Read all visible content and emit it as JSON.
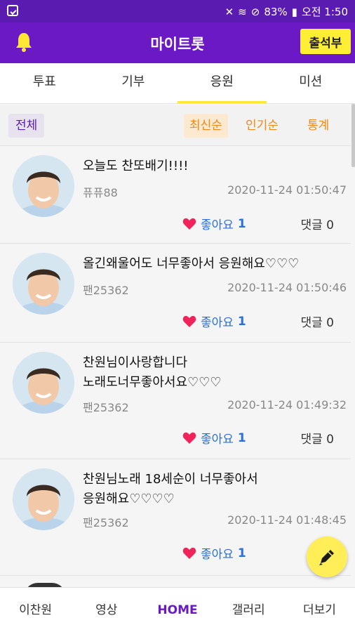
{
  "statusbar": {
    "battery": "83%",
    "time_label": "오전 1:50"
  },
  "appbar": {
    "title": "마이트롯",
    "attendance_label": "출석부"
  },
  "tabs": [
    {
      "label": "투표"
    },
    {
      "label": "기부"
    },
    {
      "label": "응원",
      "active": true
    },
    {
      "label": "미션"
    }
  ],
  "filters": {
    "all_label": "전체",
    "latest_label": "최신순",
    "popular_label": "인기순",
    "stats_label": "통계"
  },
  "posts": [
    {
      "text": "오늘도 찬또배기!!!!",
      "author": "퓨퓨88",
      "date": "2020-11-24 01:50:47",
      "like_label": "좋아요",
      "like_count": "1",
      "comment_label": "댓글",
      "comment_count": "0"
    },
    {
      "text": "올긴왜울어도 너무좋아서 응원해요♡♡♡",
      "author": "팬25362",
      "date": "2020-11-24 01:50:46",
      "like_label": "좋아요",
      "like_count": "1",
      "comment_label": "댓글",
      "comment_count": "0"
    },
    {
      "text": "찬원님이사랑합니다\n노래도너무좋아서요♡♡♡",
      "author": "팬25362",
      "date": "2020-11-24 01:49:32",
      "like_label": "좋아요",
      "like_count": "1",
      "comment_label": "댓글",
      "comment_count": "0"
    },
    {
      "text": "찬원님노래 18세순이 너무좋아서\n응원해요♡♡♡♡",
      "author": "팬25362",
      "date": "2020-11-24 01:48:45",
      "like_label": "좋아요",
      "like_count": "1",
      "comment_label": "댓",
      "comment_count": ""
    }
  ],
  "bottomnav": [
    {
      "label": "이찬원"
    },
    {
      "label": "영상"
    },
    {
      "label": "HOME",
      "active": true
    },
    {
      "label": "갤러리"
    },
    {
      "label": "더보기"
    }
  ],
  "colors": {
    "primary": "#6a19c4",
    "accent_yellow": "#ffee33",
    "sort_orange": "#f08a14",
    "like_blue": "#2a6fe0",
    "heart_red": "#f0245a"
  },
  "icons": {
    "bell": "bell-icon",
    "heart": "heart-icon",
    "pen": "pen-icon"
  }
}
